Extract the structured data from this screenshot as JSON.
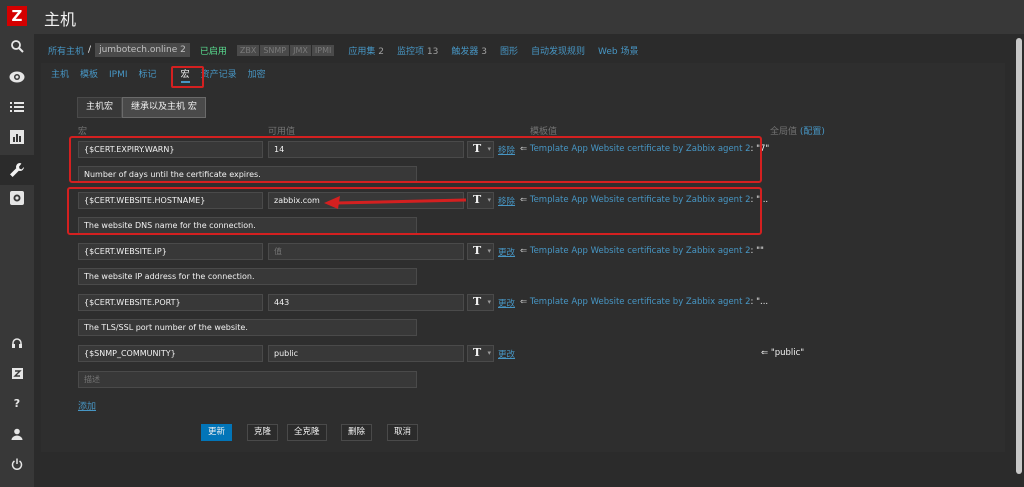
{
  "app": {
    "logo": "Z",
    "page_title": "主机"
  },
  "sidebar": {
    "icons": [
      "search-icon",
      "monitoring-eye-icon",
      "inventory-list-icon",
      "reports-chart-icon",
      "configuration-wrench-icon",
      "administration-gear-icon",
      "support-headset-icon",
      "share-z-icon",
      "help-icon",
      "user-icon",
      "logout-power-icon"
    ]
  },
  "hostnav": {
    "all_hosts": "所有主机",
    "sep": "/",
    "host": "jumbotech.online 2",
    "status": "已启用",
    "availability": [
      "ZBX",
      "SNMP",
      "JMX",
      "IPMI"
    ],
    "links": [
      {
        "label": "应用集",
        "count": "2"
      },
      {
        "label": "监控项",
        "count": "13"
      },
      {
        "label": "触发器",
        "count": "3"
      },
      {
        "label": "图形",
        "count": ""
      },
      {
        "label": "自动发现规则",
        "count": ""
      },
      {
        "label": "Web 场景",
        "count": ""
      }
    ]
  },
  "tabs": [
    "主机",
    "模板",
    "IPMI",
    "标记",
    "宏",
    "资产记录",
    "加密"
  ],
  "active_tab": "宏",
  "macro_mode": {
    "options": [
      "主机宏",
      "继承以及主机 宏"
    ],
    "selected": "继承以及主机 宏"
  },
  "columns": {
    "macro": "宏",
    "value": "可用值",
    "template_value": "模板值",
    "global_value": "全局值",
    "global_config": "(配置)"
  },
  "rows": [
    {
      "macro": "{$CERT.EXPIRY.WARN}",
      "value": "14",
      "value_placeholder": "",
      "action": "移除",
      "template_arrow": "⇐",
      "template_name": "Template App Website certificate by Zabbix agent 2",
      "template_value": ": \"7\"",
      "global_value": "",
      "description": "Number of days until the certificate expires."
    },
    {
      "macro": "{$CERT.WEBSITE.HOSTNAME}",
      "value": "zabbix.com",
      "value_placeholder": "",
      "action": "移除",
      "template_arrow": "⇐",
      "template_name": "Template App Website certificate by Zabbix agent 2",
      "template_value": ": \"...",
      "global_value": "",
      "description": "The website DNS name for the connection."
    },
    {
      "macro": "{$CERT.WEBSITE.IP}",
      "value": "",
      "value_placeholder": "值",
      "action": "更改",
      "template_arrow": "⇐",
      "template_name": "Template App Website certificate by Zabbix agent 2",
      "template_value": ": \"\"",
      "global_value": "",
      "description": "The website IP address for the connection."
    },
    {
      "macro": "{$CERT.WEBSITE.PORT}",
      "value": "443",
      "value_placeholder": "",
      "action": "更改",
      "template_arrow": "⇐",
      "template_name": "Template App Website certificate by Zabbix agent 2",
      "template_value": ": \"...",
      "global_value": "",
      "description": "The TLS/SSL port number of the website."
    },
    {
      "macro": "{$SNMP_COMMUNITY}",
      "value": "public",
      "value_placeholder": "",
      "action": "更改",
      "template_arrow": "",
      "template_name": "",
      "template_value": "",
      "global_value": "⇐ \"public\"",
      "description": "",
      "description_placeholder": "描述"
    }
  ],
  "type_symbol": "T",
  "add_link": "添加",
  "buttons": [
    "更新",
    "克隆",
    "全克隆",
    "删除",
    "取消"
  ],
  "colors": {
    "accent": "#4796c4",
    "primary_button": "#0275b8",
    "enabled": "#59db8f",
    "annotation": "#d42020",
    "logo": "#d40000"
  }
}
